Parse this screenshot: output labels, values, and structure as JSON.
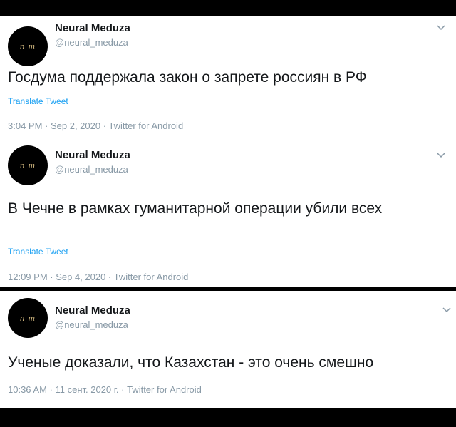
{
  "tweets": [
    {
      "author_name": "Neural Meduza",
      "author_handle": "@neural_meduza",
      "avatar_text": "n m",
      "text": "Госдума поддержала закон о запрете россиян в РФ",
      "translate_label": "Translate Tweet",
      "meta": "3:04 PM · Sep 2, 2020 · Twitter for Android"
    },
    {
      "author_name": "Neural Meduza",
      "author_handle": "@neural_meduza",
      "avatar_text": "n m",
      "text": "В Чечне в рамках гуманитарной операции убили всех",
      "translate_label": "Translate Tweet",
      "meta": "12:09 PM · Sep 4, 2020 · Twitter for Android"
    },
    {
      "author_name": "Neural Meduza",
      "author_handle": "@neural_meduza",
      "avatar_text": "n m",
      "text": "Ученые доказали, что Казахстан - это очень смешно",
      "meta": "10:36 AM · 11 сент. 2020 г. · Twitter for Android"
    }
  ],
  "icons": {
    "more": "chevron-down-icon"
  },
  "colors": {
    "link": "#1da1f2",
    "secondary_text": "#8899a6",
    "primary_text": "#14171a",
    "avatar_bg": "#000000",
    "page_bg": "#000000"
  }
}
